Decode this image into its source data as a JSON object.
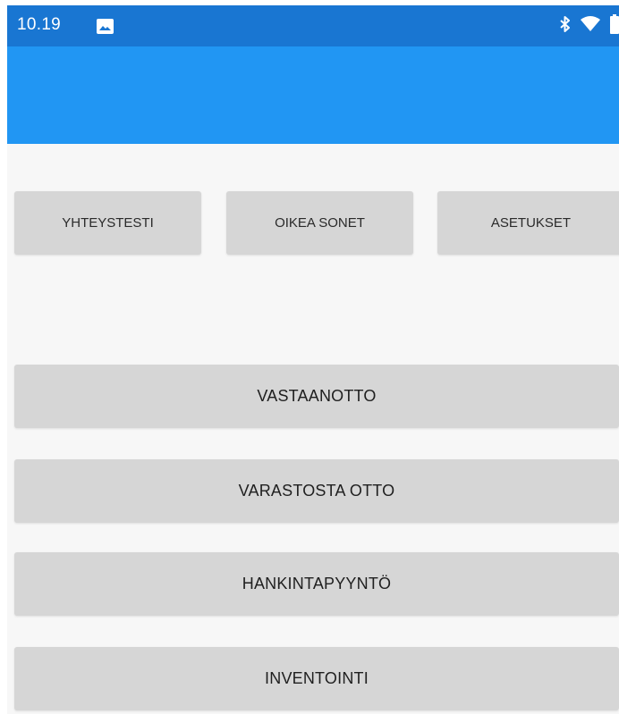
{
  "status_bar": {
    "time": "10.19",
    "icons": [
      "image-icon",
      "bluetooth-icon",
      "wifi-icon",
      "battery-icon"
    ]
  },
  "colors": {
    "status_bar": "#1976d2",
    "app_bar": "#2196f3",
    "background": "#f7f7f7",
    "button": "#d6d6d6",
    "button_text": "#222222"
  },
  "top_buttons": [
    {
      "label": "YHTEYSTESTI"
    },
    {
      "label": "OIKEA SONET"
    },
    {
      "label": "ASETUKSET"
    }
  ],
  "main_buttons": [
    {
      "label": "VASTAANOTTO"
    },
    {
      "label": "VARASTOSTA OTTO"
    },
    {
      "label": "HANKINTAPYYNTÖ"
    },
    {
      "label": "INVENTOINTI"
    }
  ]
}
